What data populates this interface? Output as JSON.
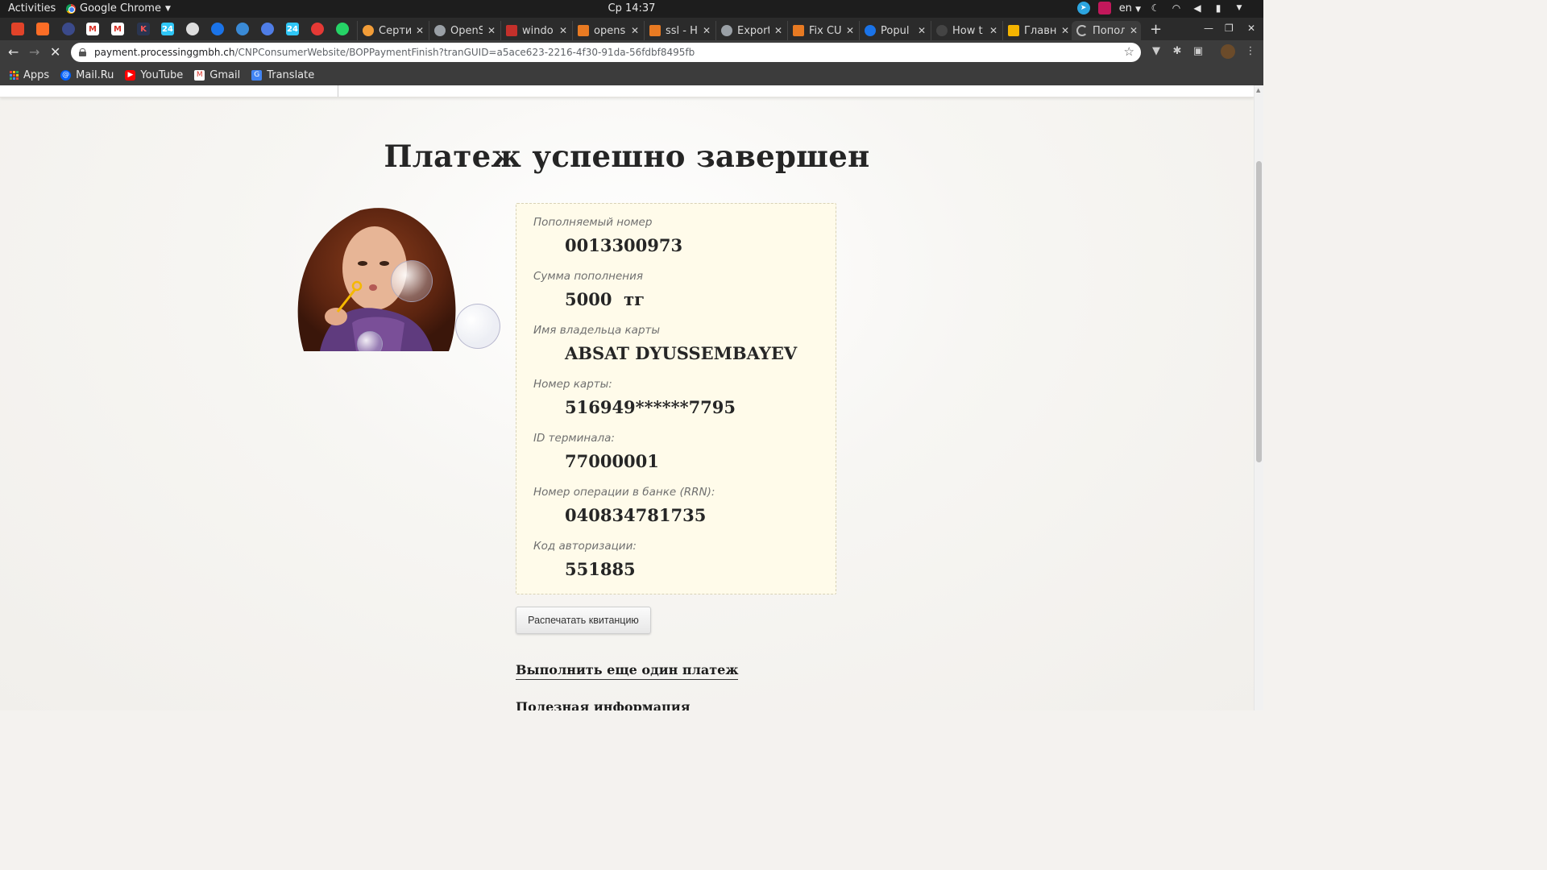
{
  "system_bar": {
    "activities": "Activities",
    "app_name": "Google Chrome",
    "clock": "Ср 14:37",
    "lang": "en"
  },
  "tabs": [
    {
      "title": "Серти",
      "fav_color": "#f29d38"
    },
    {
      "title": "OpenS",
      "fav_color": "#9aa0a6"
    },
    {
      "title": "windo",
      "fav_color": "#c4302b"
    },
    {
      "title": "opens",
      "fav_color": "#e87a22"
    },
    {
      "title": "ssl - Hc",
      "fav_color": "#e87a22"
    },
    {
      "title": "Export",
      "fav_color": "#9aa0a6"
    },
    {
      "title": "Fix CU",
      "fav_color": "#e87a22"
    },
    {
      "title": "Popul",
      "fav_color": "#1a73e8"
    },
    {
      "title": "How t",
      "fav_color": "#444444"
    },
    {
      "title": "Главн",
      "fav_color": "#f4b400"
    },
    {
      "title": "Попол",
      "fav_color": "#9aa0a6"
    }
  ],
  "address": {
    "host": "payment.processinggmbh.ch",
    "path": "/CNPConsumerWebsite/BOPPaymentFinish?tranGUID=a5ace623-2216-4f30-91da-56fdbf8495fb"
  },
  "bookmarks": [
    {
      "label": "Apps",
      "icon": "apps-grid-icon"
    },
    {
      "label": "Mail.Ru",
      "icon": "mailru-icon"
    },
    {
      "label": "YouTube",
      "icon": "youtube-icon"
    },
    {
      "label": "Gmail",
      "icon": "gmail-icon"
    },
    {
      "label": "Translate",
      "icon": "translate-icon"
    }
  ],
  "page": {
    "heading": "Платеж успешно завершен",
    "fields": [
      {
        "label": "Пополняемый номер",
        "value": "0013300973"
      },
      {
        "label": "Сумма пополнения",
        "value": "5000  тг"
      },
      {
        "label": "Имя владельца карты",
        "value": "ABSAT DYUSSEMBAYEV"
      },
      {
        "label": "Номер карты:",
        "value": "516949******7795"
      },
      {
        "label": "ID терминала:",
        "value": "77000001"
      },
      {
        "label": "Номер операции в банке (RRN):",
        "value": "040834781735"
      },
      {
        "label": "Код авторизации:",
        "value": "551885"
      }
    ],
    "print_button": "Распечатать квитанцию",
    "another_payment_link": "Выполнить еще один платеж",
    "useful_info": "Полезная информация"
  },
  "colors": {
    "receipt_bg": "#fffbea",
    "receipt_border": "#d8d2b6",
    "heading": "#252525"
  }
}
